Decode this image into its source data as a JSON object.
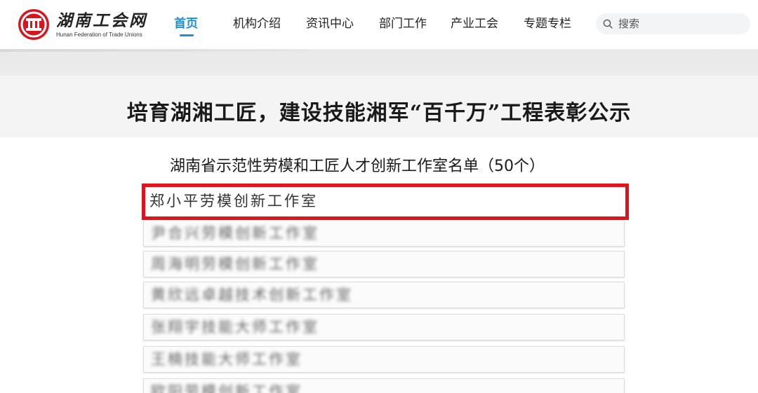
{
  "header": {
    "logo_cn": "湖南工会网",
    "logo_en": "Hunan Federation of Trade Unions",
    "nav": [
      {
        "label": "首页",
        "active": true
      },
      {
        "label": "机构介绍",
        "active": false
      },
      {
        "label": "资讯中心",
        "active": false
      },
      {
        "label": "部门工作",
        "active": false
      },
      {
        "label": "产业工会",
        "active": false
      },
      {
        "label": "专题专栏",
        "active": false
      }
    ],
    "search": {
      "placeholder": "搜索"
    }
  },
  "page": {
    "title": "培育湖湘工匠，建设技能湘军“百千万”工程表彰公示"
  },
  "document": {
    "subtitle": "湖南省示范性劳模和工匠人才创新工作室名单（50个）",
    "rows": [
      {
        "text": "郑小平劳模创新工作室",
        "highlight": true
      },
      {
        "text": "尹合兴劳模创新工作室",
        "highlight": false
      },
      {
        "text": "周海明劳模创新工作室",
        "highlight": false
      },
      {
        "text": "黄欣远卓越技术创新工作室",
        "highlight": false
      },
      {
        "text": "张翔宇技能大师工作室",
        "highlight": false
      },
      {
        "text": "王楠技能大师工作室",
        "highlight": false
      },
      {
        "text": "欧阳劳模创新工作室",
        "highlight": false
      }
    ]
  },
  "colors": {
    "accent": "#1d8fd6",
    "highlight_border": "#e0121b",
    "logo_red": "#d6161f"
  }
}
